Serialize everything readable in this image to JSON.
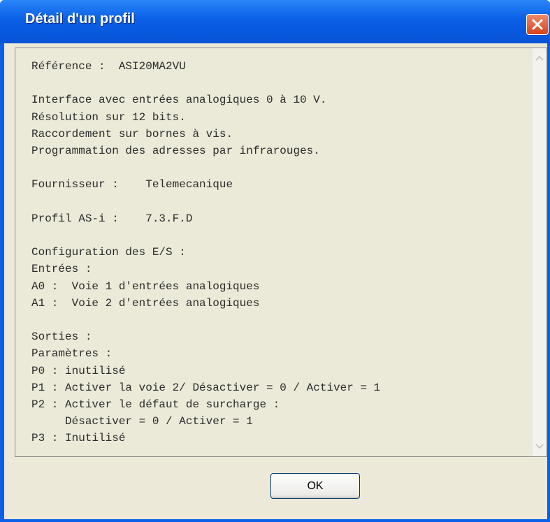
{
  "window": {
    "title": "Détail d'un profil",
    "close_label": "X"
  },
  "profile_text": [
    "Référence :  ASI20MA2VU",
    "",
    "Interface avec entrées analogiques 0 à 10 V.",
    "Résolution sur 12 bits.",
    "Raccordement sur bornes à vis.",
    "Programmation des adresses par infrarouges.",
    "",
    "Fournisseur :    Telemecanique",
    "",
    "Profil AS-i :    7.3.F.D",
    "",
    "Configuration des E/S :",
    "Entrées :",
    "A0 :  Voie 1 d'entrées analogiques",
    "A1 :  Voie 2 d'entrées analogiques",
    "",
    "Sorties :",
    "Paramètres :",
    "P0 : inutilisé",
    "P1 : Activer la voie 2/ Désactiver = 0 / Activer = 1",
    "P2 : Activer le défaut de surcharge :",
    "     Désactiver = 0 / Activer = 1",
    "P3 : Inutilisé"
  ],
  "buttons": {
    "ok_label": "OK"
  },
  "icons": {
    "close": "close-icon",
    "scroll_up": "chevron-up-icon",
    "scroll_down": "chevron-down-icon"
  }
}
